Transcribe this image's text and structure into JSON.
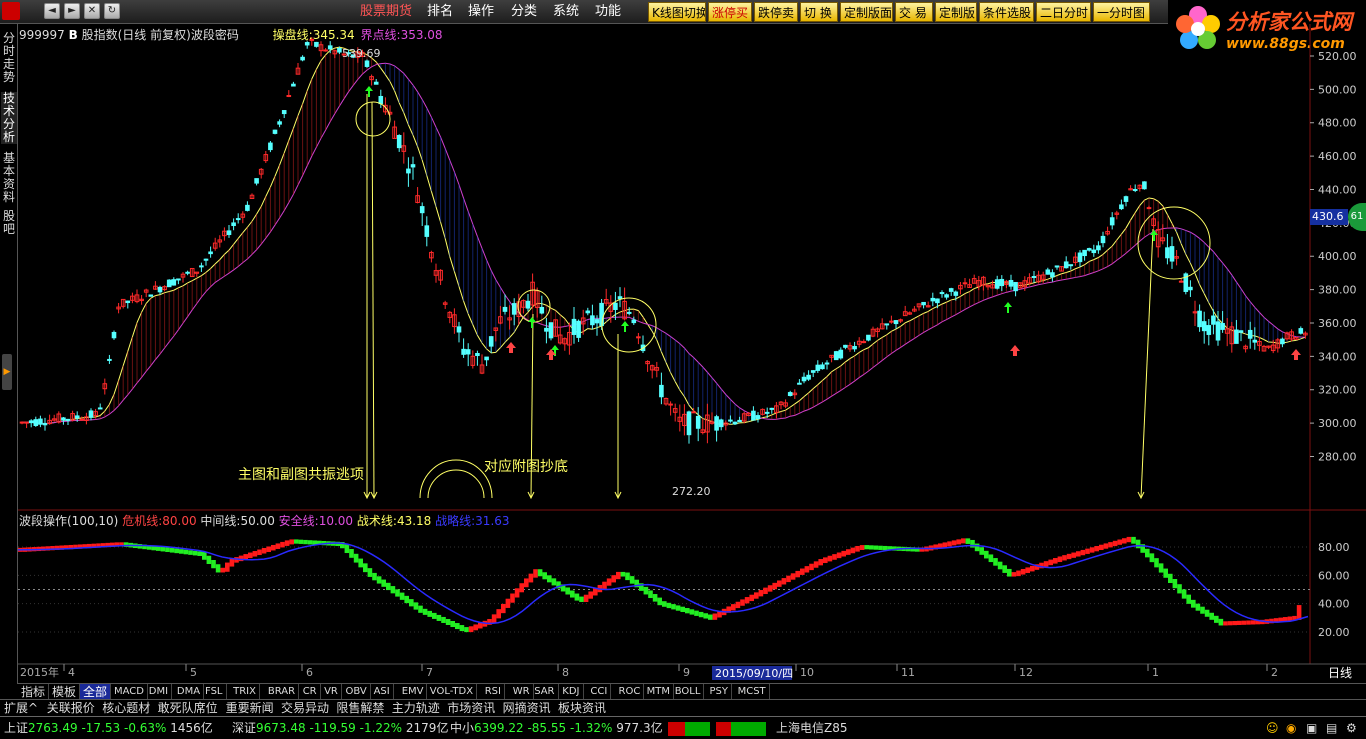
{
  "menu": {
    "stock_futures": "股票期货",
    "rank": "排名",
    "operate": "操作",
    "category": "分类",
    "system": "系统",
    "function": "功能"
  },
  "toolbar": [
    "K线图切换",
    "涨停买",
    "跌停卖",
    "切 换",
    "定制版面",
    "交 易",
    "定制版",
    "条件选股",
    "二日分时",
    "一分时图"
  ],
  "brand": {
    "name": "分析家公式网",
    "url": "www.88gs.com"
  },
  "side_tabs": [
    "分时走势",
    "技术分析",
    "基本资料",
    "股吧"
  ],
  "main_header": {
    "code": "999997",
    "b_mark": "B",
    "name": "股指数(日线 前复权)",
    "formula": "波段密码",
    "cao_label": "操盘线:",
    "cao_value": "345.34",
    "jie_label": "界点线:",
    "jie_value": "353.08"
  },
  "annotations": {
    "high": "539.69",
    "low": "272.20",
    "text1": "主图和副图共振逃项",
    "text2": "对应附图抄底"
  },
  "price_axis": [
    "520.00",
    "500.00",
    "480.00",
    "460.00",
    "440.00",
    "420.00",
    "400.00",
    "380.00",
    "360.00",
    "340.00",
    "320.00",
    "300.00",
    "280.00"
  ],
  "price_tag": "430.6",
  "price_badge": "61",
  "sub_header": {
    "name": "波段操作(100,10)",
    "l1": "危机线:",
    "v1": "80.00",
    "l2": "中间线:",
    "v2": "50.00",
    "l3": "安全线:",
    "v3": "10.00",
    "l4": "战术线:",
    "v4": "43.18",
    "l5": "战略线:",
    "v5": "31.63"
  },
  "sub_axis": [
    "80.00",
    "60.00",
    "40.00",
    "20.00"
  ],
  "date_axis": {
    "year": "2015年",
    "months": [
      "4",
      "5",
      "6",
      "7",
      "8",
      "9",
      "10",
      "11",
      "12",
      "1",
      "2"
    ],
    "cursor": "2015/09/10/四",
    "period": "日线"
  },
  "indicator_tabs": [
    "指标",
    "模板",
    "全部",
    "MACD",
    "DMI",
    "DMA",
    "FSL",
    "TRIX",
    "BRAR",
    "CR",
    "VR",
    "OBV",
    "ASI",
    "EMV",
    "VOL-TDX",
    "RSI",
    "WR",
    "SAR",
    "KDJ",
    "CCI",
    "ROC",
    "MTM",
    "BOLL",
    "PSY",
    "MCST"
  ],
  "section_tabs": [
    "扩展^",
    "关联报价",
    "核心题材",
    "敢死队席位",
    "重要新闻",
    "交易异动",
    "限售解禁",
    "主力轨迹",
    "市场资讯",
    "网摘资讯",
    "板块资讯"
  ],
  "status": {
    "sh_label": "上证",
    "sh_val": "2763.49",
    "sh_chg": "-17.53",
    "sh_pct": "-0.63%",
    "sh_amt": "1456亿",
    "sz_label": "深证",
    "sz_val": "9673.48",
    "sz_chg": "-119.59",
    "sz_pct": "-1.22%",
    "sz_amt": "2179亿",
    "zx_label": "中小",
    "zx_val": "6399.22",
    "zx_chg": "-85.55",
    "zx_pct": "-1.32%",
    "zx_amt": "977.3亿",
    "server": "上海电信Z85"
  },
  "colors": {
    "up": "#ff2a2a",
    "down": "#5ff",
    "ma_yellow": "#ffff66",
    "ma_magenta": "#d040d0",
    "osc_up": "#ff1a1a",
    "osc_down": "#22ee22",
    "osc_line": "#2a2aff"
  }
}
